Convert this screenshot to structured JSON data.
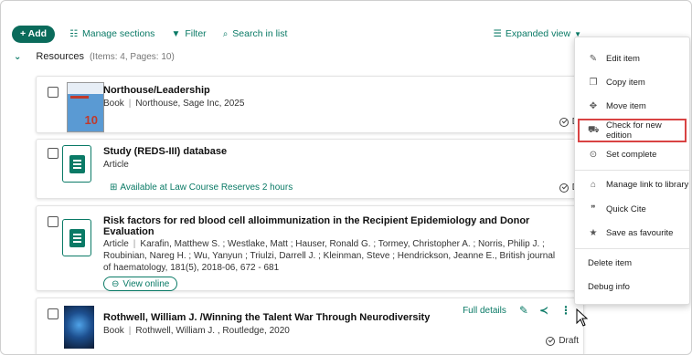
{
  "toolbar": {
    "add_label": "+ Add",
    "manage_sections_label": "Manage sections",
    "filter_label": "Filter",
    "search_label": "Search in list",
    "view_label": "Expanded view"
  },
  "section": {
    "title": "Resources",
    "meta": "(Items: 4, Pages: 10)"
  },
  "items": [
    {
      "title": "Northouse/Leadership",
      "type": "Book",
      "details": "Northouse, Sage Inc, 2025",
      "status": "D",
      "thumb_number": "10"
    },
    {
      "title": "Study (REDS-III) database",
      "type": "Article",
      "availability": "Available at Law Course Reserves 2 hours",
      "status": "D"
    },
    {
      "title_line1": "Risk factors for red blood cell alloimmunization in the Recipient Epidemiology and Donor",
      "title_line2": "Evaluation",
      "type": "Article",
      "details_line1": "Karafin, Matthew S. ; Westlake, Matt ; Hauser, Ronald G. ; Tormey, Christopher A. ; Norris, Philip J. ;",
      "details_line2": "Roubinian, Nareg H. ; Wu, Yanyun ; Triulzi, Darrell J. ; Kleinman, Steve ; Hendrickson, Jeanne E., British journal",
      "details_line3": "of haematology, 181(5), 2018-06, 672 - 681",
      "view_online": "View online"
    },
    {
      "title": "Rothwell, William J. /Winning the Talent War Through Neurodiversity",
      "type": "Book",
      "details": "Rothwell, William J. , Routledge, 2020",
      "full_details": "Full details",
      "status": "Draft"
    }
  ],
  "menu": {
    "edit": "Edit item",
    "copy": "Copy item",
    "move": "Move item",
    "check_edition": "Check for new edition",
    "set_complete": "Set complete",
    "manage_link": "Manage link to library",
    "quick_cite": "Quick Cite",
    "save_favourite": "Save as favourite",
    "delete": "Delete item",
    "debug": "Debug info"
  },
  "colors": {
    "accent": "#0a7a66",
    "highlight_border": "#d94343"
  }
}
